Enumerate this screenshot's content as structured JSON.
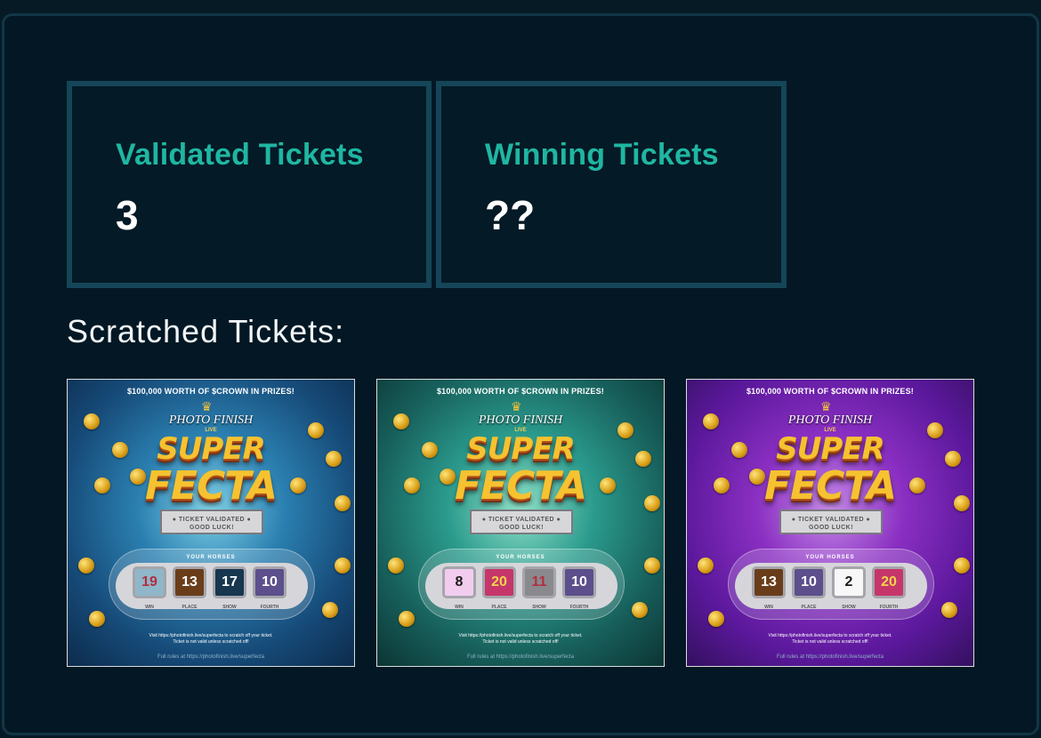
{
  "stats": {
    "validated": {
      "label": "Validated Tickets",
      "value": "3"
    },
    "winning": {
      "label": "Winning Tickets",
      "value": "??"
    }
  },
  "section_title": "Scratched Tickets:",
  "ticket_common": {
    "top_text": "$100,000 WORTH OF $CROWN IN PRIZES!",
    "brand": "PHOTO FINISH",
    "brand_sub": "LIVE",
    "title_line1": "SUPER",
    "title_line2": "FECTA",
    "validated_line1": "● TICKET VALIDATED ●",
    "validated_line2": "GOOD LUCK!",
    "your_horses": "YOUR HORSES",
    "pos_labels": [
      "WIN",
      "PLACE",
      "SHOW",
      "FOURTH"
    ],
    "footer_line1": "Visit https://photofinish.live/superfecta to scratch off your ticket.",
    "footer_line2": "Ticket is not valid unless scratched off!",
    "footer_rules": "Full rules at https://photofinish.live/superfecta"
  },
  "tickets": [
    {
      "theme": "blue",
      "horses": [
        {
          "number": "19",
          "bg": "#8fb7c9",
          "fg": "#b32d3f"
        },
        {
          "number": "13",
          "bg": "#6a3d1a",
          "fg": "#ffffff"
        },
        {
          "number": "17",
          "bg": "#17364f",
          "fg": "#ffffff"
        },
        {
          "number": "10",
          "bg": "#5c4f8c",
          "fg": "#ffffff"
        }
      ]
    },
    {
      "theme": "teal",
      "horses": [
        {
          "number": "8",
          "bg": "#f1ccef",
          "fg": "#1a1a1a"
        },
        {
          "number": "20",
          "bg": "#c6366a",
          "fg": "#f2d44a"
        },
        {
          "number": "11",
          "bg": "#8a8a8e",
          "fg": "#b32d3f"
        },
        {
          "number": "10",
          "bg": "#5c4f8c",
          "fg": "#ffffff"
        }
      ]
    },
    {
      "theme": "purple",
      "horses": [
        {
          "number": "13",
          "bg": "#6a3d1a",
          "fg": "#ffffff"
        },
        {
          "number": "10",
          "bg": "#5c4f8c",
          "fg": "#ffffff"
        },
        {
          "number": "2",
          "bg": "#f7f7f7",
          "fg": "#1a1a1a"
        },
        {
          "number": "20",
          "bg": "#c6366a",
          "fg": "#f2d44a"
        }
      ]
    }
  ],
  "colors": {
    "accent": "#1fb6a2",
    "background": "#031824",
    "card_border": "#154558"
  }
}
